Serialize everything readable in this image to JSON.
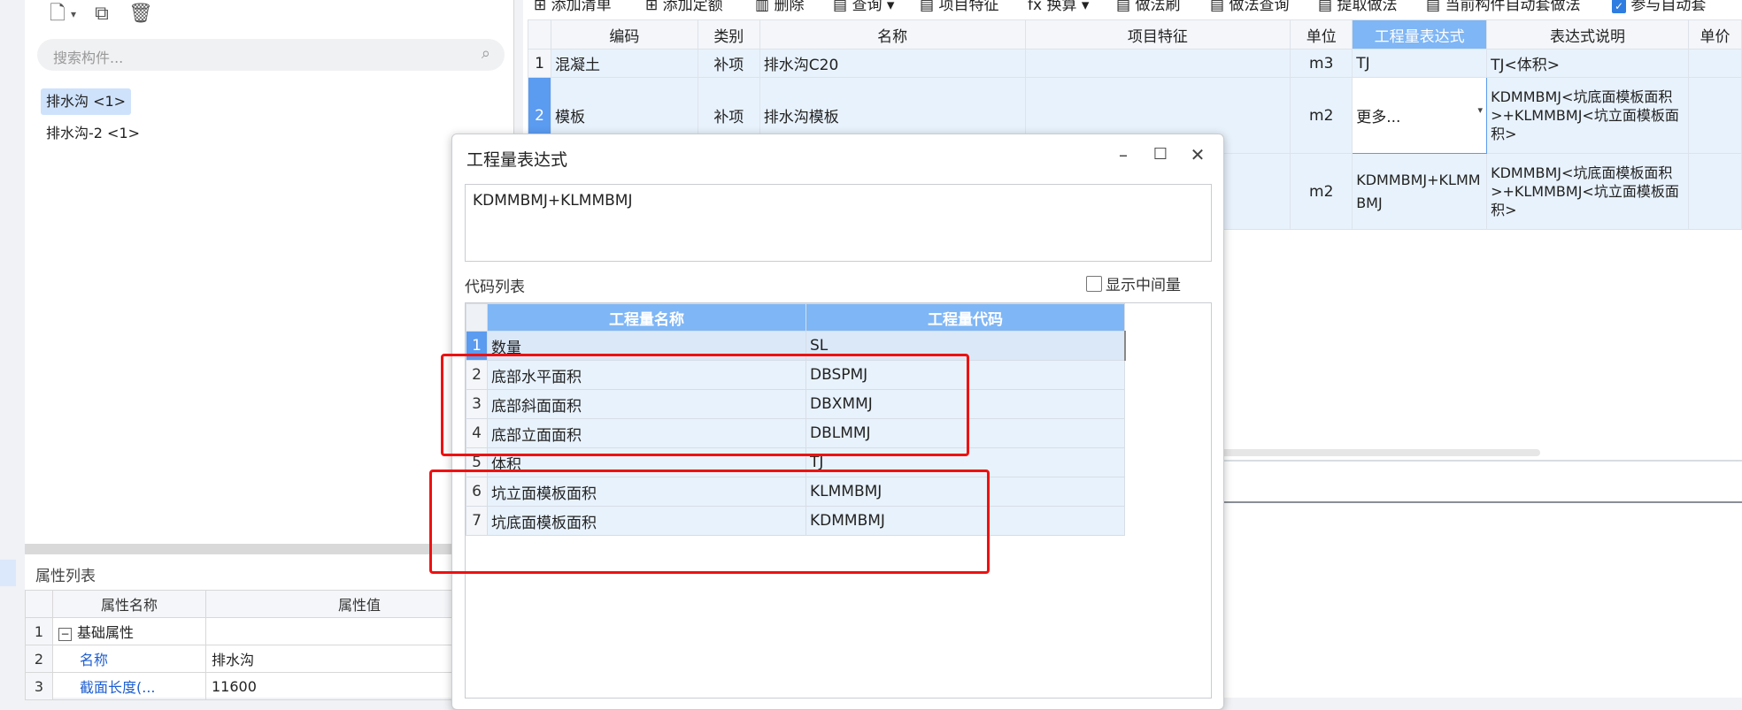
{
  "left": {
    "search_placeholder": "搜索构件...",
    "tree_items": [
      "排水沟 <1>",
      "排水沟-2 <1>"
    ]
  },
  "properties": {
    "title": "属性列表",
    "col_name": "属性名称",
    "col_value": "属性值",
    "rows": [
      {
        "n": "1",
        "name": "基础属性",
        "value": ""
      },
      {
        "n": "2",
        "name": "名称",
        "value": "排水沟"
      },
      {
        "n": "3",
        "name": "截面长度(...",
        "value": "11600"
      }
    ]
  },
  "toolbar": {
    "add_list": "添加清单",
    "add_quota": "添加定额",
    "delete": "删除",
    "query": "查询",
    "item_feature": "项目特征",
    "convert": "换算",
    "method_brush": "做法刷",
    "method_query": "做法查询",
    "extract_method": "提取做法",
    "auto_method": "当前构件自动套做法",
    "participate_auto": "参与自动套"
  },
  "grid": {
    "headers": [
      "编码",
      "类别",
      "名称",
      "项目特征",
      "单位",
      "工程量表达式",
      "表达式说明",
      "单价"
    ],
    "rows": [
      {
        "n": "1",
        "code": "混凝土",
        "type": "补项",
        "name": "排水沟C20",
        "feature": "",
        "unit": "m3",
        "expr": "TJ",
        "desc": "TJ<体积>"
      },
      {
        "n": "2",
        "code": "模板",
        "type": "补项",
        "name": "排水沟模板",
        "feature": "",
        "unit": "m2",
        "expr": "更多...",
        "desc": "KDMMBMJ<坑底面模板面积>+KLMMBMJ<坑立面模板面积>"
      },
      {
        "n": "",
        "code": "",
        "type": "",
        "name": "",
        "feature": "",
        "unit": "m2",
        "expr": "KDMMBMJ+KLMMBMJ",
        "desc": "KDMMBMJ<坑底面模板面积>+KLMMBMJ<坑立面模板面积>"
      }
    ]
  },
  "dialog": {
    "title": "工程量表达式",
    "expression": "KDMMBMJ+KLMMBMJ",
    "code_list_label": "代码列表",
    "show_intermediate": "显示中间量",
    "col_name": "工程量名称",
    "col_code": "工程量代码",
    "rows": [
      {
        "n": "1",
        "name": "数量",
        "code": "SL"
      },
      {
        "n": "2",
        "name": "底部水平面积",
        "code": "DBSPMJ"
      },
      {
        "n": "3",
        "name": "底部斜面面积",
        "code": "DBXMMJ"
      },
      {
        "n": "4",
        "name": "底部立面面积",
        "code": "DBLMMJ"
      },
      {
        "n": "5",
        "name": "体积",
        "code": "TJ"
      },
      {
        "n": "6",
        "name": "坑立面模板面积",
        "code": "KLMMBMJ"
      },
      {
        "n": "7",
        "name": "坑底面模板面积",
        "code": "KDMMBMJ"
      }
    ]
  },
  "colors": {
    "accent": "#5b9bf0",
    "header": "#7fb6f5",
    "highlight_box": "#ee1111"
  }
}
